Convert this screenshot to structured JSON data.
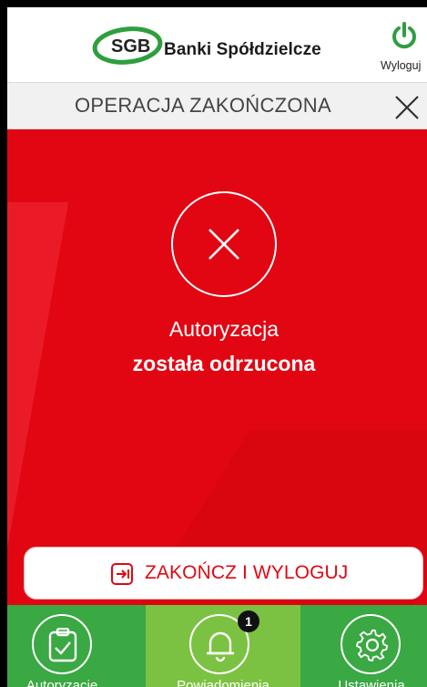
{
  "header": {
    "logo_text": "SGB",
    "brand_name": "Banki Spółdzielcze",
    "logout_label": "Wyloguj"
  },
  "titlebar": {
    "title": "OPERACJA ZAKOŃCZONA"
  },
  "result": {
    "icon": "close-icon",
    "line1": "Autoryzacja",
    "line2": "została odrzucona",
    "button_label": "ZAKOŃCZ I WYLOGUJ",
    "button_icon": "exit-icon"
  },
  "bottom_nav": {
    "items": [
      {
        "label": "Autoryzacje",
        "icon": "clipboard-check-icon",
        "active": false
      },
      {
        "label": "Powiadomienia",
        "icon": "bell-icon",
        "active": true,
        "badge": "1"
      },
      {
        "label": "Ustawienia",
        "icon": "gear-icon",
        "active": false
      }
    ]
  },
  "colors": {
    "red": "#e20613",
    "green": "#3aa843",
    "active_green": "#7cc242",
    "logo_green": "#2e9e3f"
  }
}
